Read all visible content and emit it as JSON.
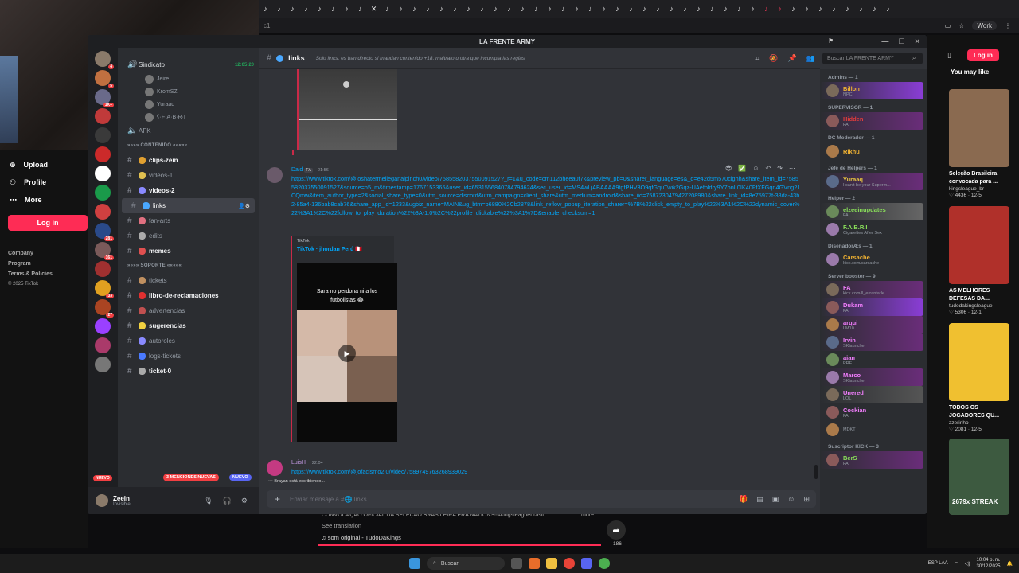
{
  "browser": {
    "tab_count": 47,
    "work_label": "Work",
    "address": "c1"
  },
  "tiktok": {
    "menu": [
      {
        "label": "Upload",
        "icon": "plus-icon"
      },
      {
        "label": "Profile",
        "icon": "person-icon"
      },
      {
        "label": "More",
        "icon": "dots-icon"
      }
    ],
    "login": "Log in",
    "footer": [
      "Company",
      "Program",
      "Terms & Policies",
      "© 2025 TikTok"
    ],
    "right_login": "Log in",
    "you_may_like": "You may like",
    "suggestions": [
      {
        "title": "Seleção Brasileira convocada para ...",
        "author": "kingsleague_br",
        "views": "4436",
        "date": "12-5"
      },
      {
        "title": "AS MELHORES DEFESAS DA...",
        "author": "tudodakingsleague",
        "views": "5306",
        "date": "12-1"
      },
      {
        "title": "TODOS OS JOGADORES QU...",
        "author": "zzerinho",
        "views": "2081",
        "date": "12-5"
      },
      {
        "title": "2679x STREAK",
        "author": "",
        "views": "",
        "date": ""
      }
    ],
    "caption": "CONVOCAÇÃO OFICIAL DA SELEÇÃO BRASILEIRA PRA NATIONS!!#kingsleaguebrasil ...",
    "more": "more",
    "see_translation": "See translation",
    "sound": "som original - TudoDaKings",
    "shares": "186"
  },
  "discord": {
    "server_name": "LA FRENTE ARMY",
    "channel_name": "links",
    "channel_topic": "Solo links, es ban directo si mandan contenido +18, maltrato u otra que incumpla las reglas",
    "search_placeholder": "Buscar LA FRENTE ARMY",
    "voice": {
      "channel": "Sindicato",
      "time": "12:05:20",
      "users": [
        "Jeire",
        "KromSZ",
        "Yuraaq",
        "ʕ·F·A·B·R·I"
      ],
      "afk": "AFK"
    },
    "cat1": "»»»» CONTENIDO «««««",
    "channels1": [
      "clips-zein",
      "videos-1",
      "videos-2",
      "links",
      "fan-arts",
      "edits",
      "memes"
    ],
    "cat2": "»»»» SOPORTE «««««",
    "channels2": [
      "tickets",
      "libro-de-reclamaciones",
      "advertencias",
      "sugerencias",
      "autoroles",
      "logs-tickets",
      "ticket-0"
    ],
    "mentions_badge": "3 MENCIONES NUEVAS",
    "nuevo": "NUEVO",
    "user": {
      "name": "Zeein",
      "status": "Invisible"
    },
    "server_badges": [
      "4",
      "5",
      "1K+",
      "",
      "",
      "",
      "",
      "",
      "",
      "281",
      "161",
      "",
      "33",
      "27",
      ""
    ],
    "msg1": {
      "author": "Daid",
      "tag": "FA",
      "time": "21:56",
      "link": "https://www.tiktok.com/@loshatermelleganalpinch0/video/7585582037550091527?_r=1&u_code=cm112bheea0f7k&preview_pb=0&sharer_language=es&_d=e42d5m570cighh&share_item_id=7585582037550091527&source=h5_m&timestamp=1767153365&user_id=6531556840784794624&sec_user_id=MS4wLjABAAAA9tgfPHV3O9qfGquTwik2Gqz-UAefbldry9Y7onL0IK40FfXFGqn4GVng21CQmw&item_author_type=2&social_share_type=0&utm_source=discord&utm_campaign=client_share&utm_medium=android&share_iid=7587230479427208980&share_link_id=8e75977f-38da-43b2-85a4-136bab8cab76&share_app_id=1233&ugbiz_name=MAIN&ug_btm=b6880%2Cb2878&link_reflow_popup_iteration_sharer=%7B%22click_empty_to_play%22%3A1%2C%22dynamic_cover%22%3A1%2C%22follow_to_play_duration%22%3A-1.0%2C%22profile_clickable%22%3A1%7D&enable_checksum=1",
      "embed_site": "TikTok",
      "embed_title": "TikTok · jhordan Perú 🇵🇪",
      "video_caption": "Sara no perdona ni a los futbolistas 😂"
    },
    "msg2": {
      "author": "LuisH",
      "time": "22:04",
      "link": "https://www.tiktok.com/@jofacismo2.0/video/7589749763268939029"
    },
    "typing": "Brayan está escribiendo...",
    "composer_placeholder": "Enviar mensaje a #🌐 links",
    "members": [
      {
        "header": "Admins — 1",
        "list": [
          {
            "name": "Billon",
            "color": "#f0b232",
            "sub": "NPC",
            "bg": "#8a3dd6"
          }
        ]
      },
      {
        "header": "SUPERVISOR — 1",
        "list": [
          {
            "name": "Hidden",
            "color": "#e23c3c",
            "sub": "FA",
            "bg": "#6a2d7a"
          }
        ]
      },
      {
        "header": "DC Moderador — 1",
        "list": [
          {
            "name": "Rikhu",
            "color": "#f0b232",
            "sub": "",
            "bg": ""
          }
        ]
      },
      {
        "header": "Jefe de Helpers — 1",
        "list": [
          {
            "name": "Yuraaq",
            "color": "#e8c540",
            "sub": "I can't be your Superm...",
            "bg": "#6a2d7a"
          }
        ]
      },
      {
        "header": "Helper — 2",
        "list": [
          {
            "name": "elzeeinupdates",
            "color": "#8ae05a",
            "sub": "FA",
            "bg": "#666"
          },
          {
            "name": "F.A.B.R.I",
            "color": "#8ae05a",
            "sub": "Cigarettes After Sex",
            "bg": ""
          }
        ]
      },
      {
        "header": "DiseñadorÆs — 1",
        "list": [
          {
            "name": "Carsache",
            "color": "#f0b232",
            "sub": "kick.com/carsache",
            "bg": ""
          }
        ]
      },
      {
        "header": "Server booster — 9",
        "list": [
          {
            "name": "FA",
            "color": "#f47fff",
            "sub": "kick.com/ll_errantarle",
            "bg": "#6a2d7a"
          },
          {
            "name": "Dukam",
            "color": "#f47fff",
            "sub": "FA",
            "bg": "#8a3dd6"
          },
          {
            "name": "arqui",
            "color": "#f47fff",
            "sub": "LM10",
            "bg": "#6a2d7a"
          },
          {
            "name": "Irvin",
            "color": "#f47fff",
            "sub": "SKlauncher",
            "bg": "#6a2d7a"
          },
          {
            "name": "aian",
            "color": "#f47fff",
            "sub": "PRE",
            "bg": ""
          },
          {
            "name": "Marco",
            "color": "#f47fff",
            "sub": "SKlauncher",
            "bg": "#6a2d7a"
          },
          {
            "name": "Unered",
            "color": "#f47fff",
            "sub": "LOL",
            "bg": "#555"
          },
          {
            "name": "Cockian",
            "color": "#f47fff",
            "sub": "FA",
            "bg": ""
          },
          {
            "name": "",
            "color": "#f47fff",
            "sub": "MDKT",
            "bg": ""
          }
        ]
      },
      {
        "header": "Suscriptor KICK — 3",
        "list": [
          {
            "name": "BerS",
            "color": "#8ae05a",
            "sub": "FA",
            "bg": "#6a2d7a"
          }
        ]
      }
    ]
  },
  "taskbar": {
    "search": "Buscar",
    "time": "10:04 p. m.",
    "date": "30/12/2025",
    "lang": "ESP LAA"
  }
}
